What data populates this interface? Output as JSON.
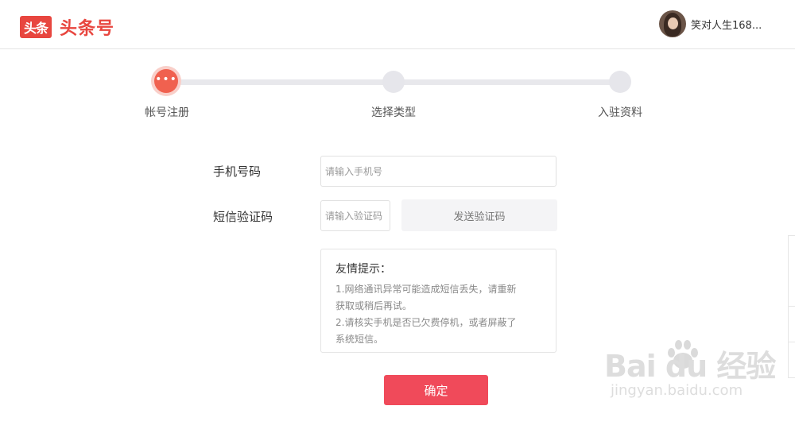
{
  "header": {
    "logo_badge": "头条",
    "logo_text": "头条号",
    "username": "笑对人生168..."
  },
  "steps": [
    {
      "label": "帐号注册",
      "active": true,
      "icon": "•••"
    },
    {
      "label": "选择类型",
      "active": false
    },
    {
      "label": "入驻资料",
      "active": false
    }
  ],
  "form": {
    "phone_label": "手机号码",
    "phone_placeholder": "请输入手机号",
    "code_label": "短信验证码",
    "code_placeholder": "请输入验证码",
    "send_code_label": "发送验证码",
    "confirm_label": "确定"
  },
  "tips": {
    "title": "友情提示：",
    "lines": [
      "1.网络通讯异常可能造成短信丢失，请重新",
      "获取或稍后再试。",
      "2.请核实手机是否已欠费停机，或者屏蔽了",
      "系统短信。"
    ]
  },
  "watermark": {
    "main": "Bai du 经验",
    "sub": "jingyan.baidu.com"
  },
  "colors": {
    "brand_red": "#e8463f",
    "confirm_button": "#f04a5a",
    "active_step": "#f0614f"
  }
}
